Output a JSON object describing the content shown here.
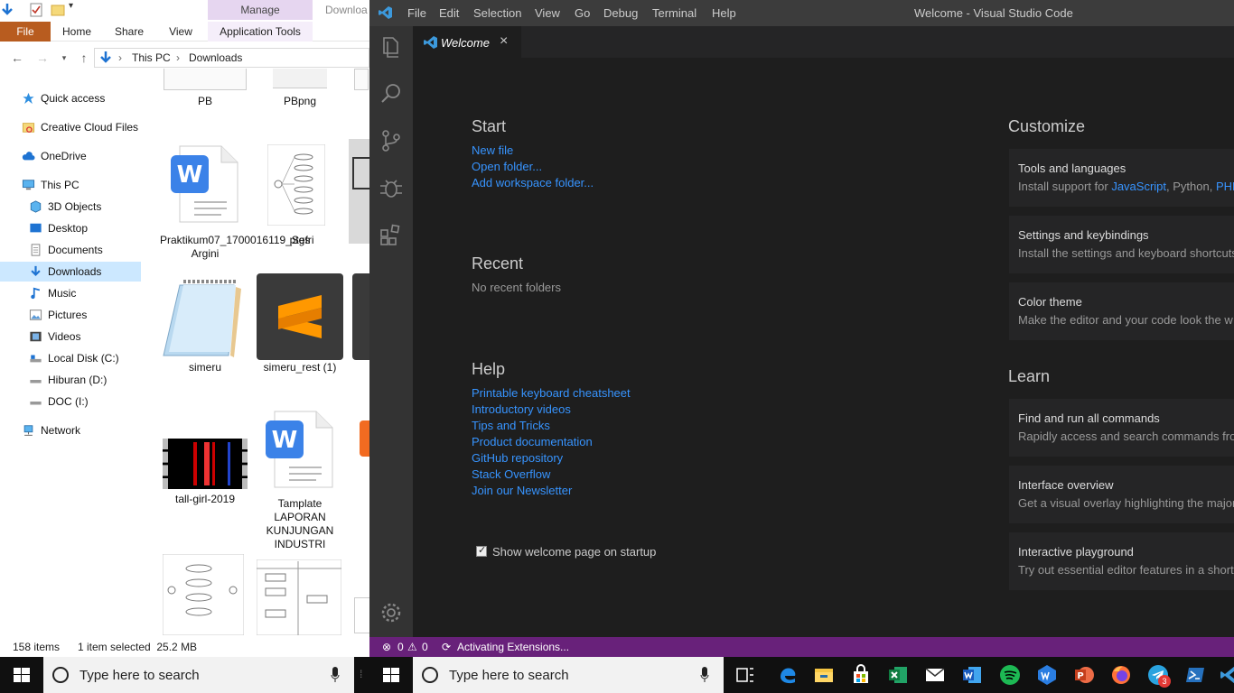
{
  "explorer": {
    "ribbon_contextual": "Manage",
    "title_partial": "Downloa",
    "tabs": [
      "File",
      "Home",
      "Share",
      "View",
      "Application Tools"
    ],
    "breadcrumb": [
      "This PC",
      "Downloads"
    ],
    "nav": [
      {
        "label": "Quick access",
        "icon": "star-icon"
      },
      {
        "label": "Creative Cloud Files",
        "icon": "creative-cloud-icon"
      },
      {
        "label": "OneDrive",
        "icon": "cloud-icon"
      },
      {
        "label": "This PC",
        "icon": "computer-icon"
      },
      {
        "label": "3D Objects",
        "icon": "cube-icon"
      },
      {
        "label": "Desktop",
        "icon": "desktop-icon"
      },
      {
        "label": "Documents",
        "icon": "document-icon"
      },
      {
        "label": "Downloads",
        "icon": "download-icon"
      },
      {
        "label": "Music",
        "icon": "music-icon"
      },
      {
        "label": "Pictures",
        "icon": "pictures-icon"
      },
      {
        "label": "Videos",
        "icon": "videos-icon"
      },
      {
        "label": "Local Disk (C:)",
        "icon": "drive-icon"
      },
      {
        "label": "Hiburan (D:)",
        "icon": "drive-icon"
      },
      {
        "label": "DOC (I:)",
        "icon": "drive-icon"
      },
      {
        "label": "Network",
        "icon": "network-icon"
      }
    ],
    "files": [
      {
        "label": "PB"
      },
      {
        "label": "PBpng"
      },
      {
        "label": "Praktikum07_1700016119_Sefri Argini"
      },
      {
        "label": "ptgs"
      },
      {
        "label": "simeru"
      },
      {
        "label": "simeru_rest (1)"
      },
      {
        "label": "tall-girl-2019"
      },
      {
        "label": "Tamplate LAPORAN KUNJUNGAN INDUSTRI"
      }
    ],
    "status": {
      "items": "158 items",
      "selected": "1 item selected  25.2 MB"
    }
  },
  "vscode": {
    "menu": [
      "File",
      "Edit",
      "Selection",
      "View",
      "Go",
      "Debug",
      "Terminal",
      "Help"
    ],
    "window_title": "Welcome - Visual Studio Code",
    "tab": "Welcome",
    "start": {
      "heading": "Start",
      "links": [
        "New file",
        "Open folder...",
        "Add workspace folder..."
      ]
    },
    "recent": {
      "heading": "Recent",
      "empty": "No recent folders"
    },
    "help": {
      "heading": "Help",
      "links": [
        "Printable keyboard cheatsheet",
        "Introductory videos",
        "Tips and Tricks",
        "Product documentation",
        "GitHub repository",
        "Stack Overflow",
        "Join our Newsletter"
      ]
    },
    "customize": {
      "heading": "Customize",
      "cards": [
        {
          "title": "Tools and languages",
          "desc_prefix": "Install support for ",
          "desc_links": [
            "JavaScript",
            "PHP"
          ],
          "desc_mid": ", Python, "
        },
        {
          "title": "Settings and keybindings",
          "desc": "Install the settings and keyboard shortcuts"
        },
        {
          "title": "Color theme",
          "desc": "Make the editor and your code look the w"
        }
      ]
    },
    "learn": {
      "heading": "Learn",
      "cards": [
        {
          "title": "Find and run all commands",
          "desc": "Rapidly access and search commands from"
        },
        {
          "title": "Interface overview",
          "desc": "Get a visual overlay highlighting the major"
        },
        {
          "title": "Interactive playground",
          "desc": "Try out essential editor features in a short"
        }
      ]
    },
    "show_on_startup": "Show welcome page on startup",
    "status": {
      "errors": "0",
      "warnings": "0",
      "activity": "Activating Extensions..."
    }
  },
  "taskbar": {
    "search_placeholder": "Type here to search",
    "apps": [
      "task-view-icon",
      "edge-icon",
      "file-explorer-icon",
      "store-icon",
      "excel-icon",
      "mail-icon",
      "word-icon",
      "spotify-icon",
      "wps-icon",
      "powerpoint-icon",
      "firefox-icon",
      "telegram-icon",
      "powershell-icon",
      "vscode-icon"
    ],
    "telegram_badge": "3"
  },
  "colors": {
    "vscode_status": "#68217a",
    "link": "#3794ff",
    "file_tab": "#b85c1f",
    "manage_tab": "#e6d6f0"
  }
}
